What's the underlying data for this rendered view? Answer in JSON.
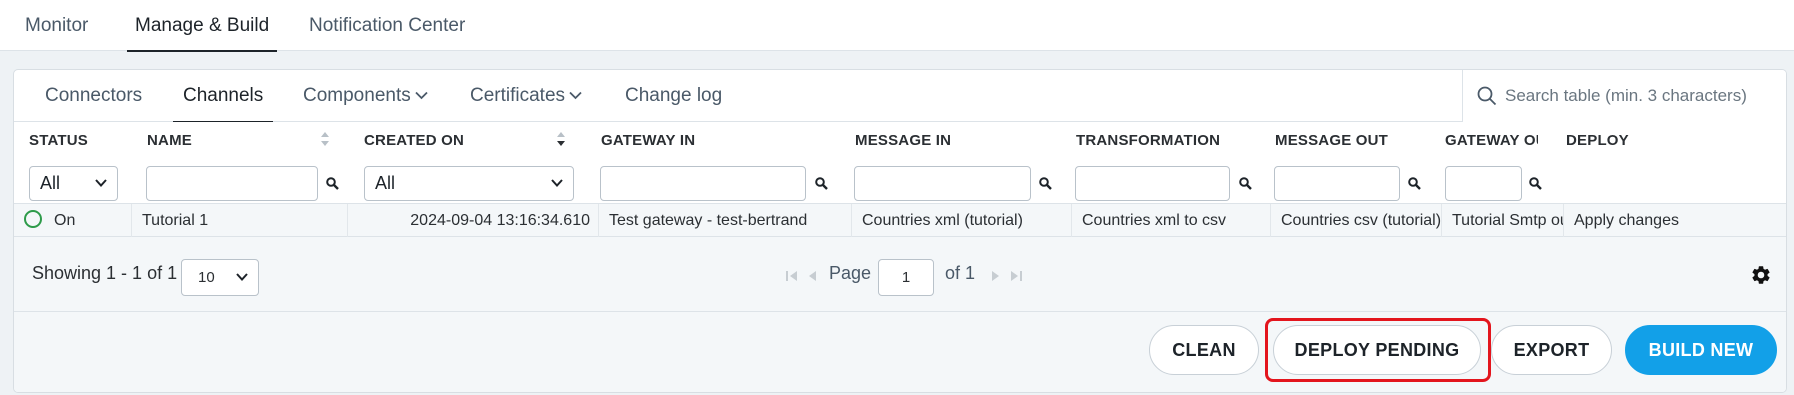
{
  "topnav": {
    "tabs": [
      {
        "label": "Monitor"
      },
      {
        "label": "Manage & Build"
      },
      {
        "label": "Notification Center"
      }
    ]
  },
  "subnav": {
    "tabs": [
      {
        "label": "Connectors"
      },
      {
        "label": "Channels"
      },
      {
        "label": "Components"
      },
      {
        "label": "Certificates"
      },
      {
        "label": "Change log"
      }
    ]
  },
  "search": {
    "placeholder": "Search table (min. 3 characters)"
  },
  "table": {
    "columns": [
      {
        "label": "STATUS"
      },
      {
        "label": "NAME"
      },
      {
        "label": "CREATED ON"
      },
      {
        "label": "GATEWAY IN"
      },
      {
        "label": "MESSAGE IN"
      },
      {
        "label": "TRANSFORMATION"
      },
      {
        "label": "MESSAGE OUT"
      },
      {
        "label": "GATEWAY OUT"
      },
      {
        "label": "DEPLOY"
      }
    ],
    "filters": {
      "status": "All",
      "created_on": "All"
    },
    "rows": [
      {
        "status": "On",
        "name": "Tutorial 1",
        "created_on": "2024-09-04 13:16:34.610",
        "gateway_in": "Test gateway - test-bertrand",
        "message_in": "Countries xml (tutorial)",
        "transformation": "Countries xml to csv",
        "message_out": "Countries csv (tutorial)",
        "gateway_out": "Tutorial Smtp out",
        "deploy": "Apply changes"
      }
    ]
  },
  "pager": {
    "showing": "Showing 1 - 1 of 1",
    "page_size": "10",
    "page_label": "Page",
    "page_value": "1",
    "of_label": "of 1"
  },
  "footer": {
    "clean": "CLEAN",
    "deploy_pending": "DEPLOY PENDING",
    "export": "EXPORT",
    "build_new": "BUILD NEW"
  },
  "colors": {
    "accent": "#12a0e8",
    "status_on": "#2e9b4a",
    "highlight": "#e3151d"
  }
}
